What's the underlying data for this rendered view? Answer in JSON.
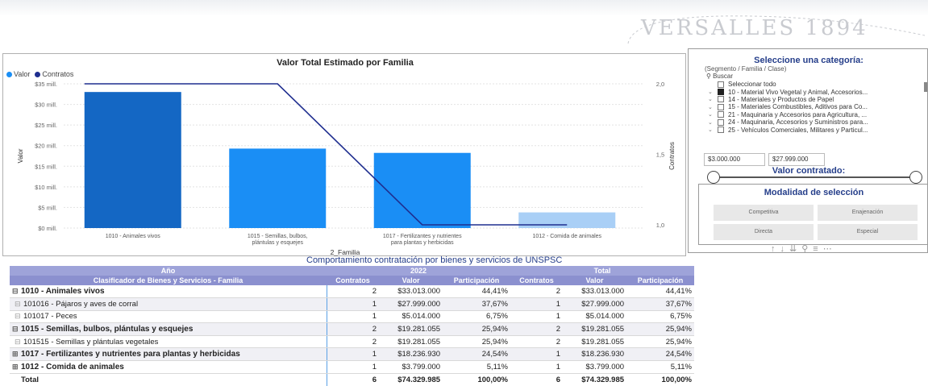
{
  "brand": {
    "logo_text": "VERSALLES 1894"
  },
  "chart_data": {
    "type": "bar",
    "title": "Valor Total Estimado por Familia",
    "xlabel": "2_Familia",
    "ylabel": "Valor",
    "y2label": "Contratos",
    "legend": [
      "Valor",
      "Contratos"
    ],
    "categories": [
      "1010 - Animales vivos",
      "1015 - Semillas, bulbos, plántulas y esquejes",
      "1017 - Fertilizantes y nutrientes para plantas y herbicidas",
      "1012 - Comida de animales"
    ],
    "category_lines": [
      [
        "1010 - Animales vivos"
      ],
      [
        "1015 - Semillas, bulbos,",
        "plántulas y esquejes"
      ],
      [
        "1017 - Fertilizantes y nutrientes",
        "para plantas y herbicidas"
      ],
      [
        "1012 - Comida de animales"
      ]
    ],
    "series": [
      {
        "name": "Valor",
        "axis": "left",
        "values": [
          33013000,
          19281055,
          18236930,
          3799000
        ],
        "colors": [
          "#1467c4",
          "#1a8ef5",
          "#1a8ef5",
          "#a9cff6"
        ]
      },
      {
        "name": "Contratos",
        "axis": "right",
        "type": "line",
        "values": [
          2,
          2,
          1,
          1
        ],
        "color": "#1f2e8f"
      }
    ],
    "y_ticks": [
      "$0 mill.",
      "$5 mill.",
      "$10 mill.",
      "$15 mill.",
      "$20 mill.",
      "$25 mill.",
      "$30 mill.",
      "$35 mill."
    ],
    "y2_ticks": [
      "1,0",
      "1,5",
      "2,0"
    ],
    "ylim": [
      0,
      35000000
    ],
    "y2lim": [
      1,
      2
    ]
  },
  "category_slicer": {
    "title": "Seleccione una categoría:",
    "subtitle": "(Segmento / Familia / Clase)",
    "search_placeholder": "Buscar",
    "items": [
      {
        "label": "Seleccionar todo",
        "checked": false,
        "expand": false
      },
      {
        "label": "10 - Material Vivo Vegetal y Animal, Accesorios...",
        "checked": true,
        "expand": true
      },
      {
        "label": "14 - Materiales y Productos de Papel",
        "checked": false,
        "expand": true
      },
      {
        "label": "15 - Materiales Combustibles, Aditivos para Co...",
        "checked": false,
        "expand": true
      },
      {
        "label": "21 - Maquinaria y Accesorios para Agricultura, ...",
        "checked": false,
        "expand": true
      },
      {
        "label": "24 - Maquinaria, Accesorios y Suministros para...",
        "checked": false,
        "expand": true
      },
      {
        "label": "25 - Vehículos Comerciales, Militares y Particul...",
        "checked": false,
        "expand": true
      }
    ]
  },
  "value_slicer": {
    "title": "Valor contratado:",
    "min": "$3.000.000",
    "max": "$27.999.000"
  },
  "modality": {
    "title": "Modalidad de selección",
    "options": [
      "Competitiva",
      "Enajenación",
      "Directa",
      "Especial"
    ]
  },
  "table": {
    "title": "Comportamiento contratación por bienes y servicios de UNSPSC",
    "year_header": "Año",
    "year": "2022",
    "total_header": "Total",
    "row_header": "Clasificador de Bienes y Servicios - Familia",
    "col_headers": [
      "Contratos",
      "Valor",
      "Participación",
      "Contratos",
      "Valor",
      "Participación"
    ],
    "rows": [
      {
        "level": 1,
        "icon": "⊟",
        "label": "1010 - Animales vivos",
        "values": [
          "2",
          "$33.013.000",
          "44,41%",
          "2",
          "$33.013.000",
          "44,41%"
        ]
      },
      {
        "level": 2,
        "icon": "⊟",
        "label": "101016 - Pájaros y aves de corral",
        "values": [
          "1",
          "$27.999.000",
          "37,67%",
          "1",
          "$27.999.000",
          "37,67%"
        ]
      },
      {
        "level": 2,
        "icon": "⊟",
        "label": "101017 - Peces",
        "values": [
          "1",
          "$5.014.000",
          "6,75%",
          "1",
          "$5.014.000",
          "6,75%"
        ]
      },
      {
        "level": 1,
        "icon": "⊟",
        "label": "1015 - Semillas, bulbos, plántulas y esquejes",
        "values": [
          "2",
          "$19.281.055",
          "25,94%",
          "2",
          "$19.281.055",
          "25,94%"
        ]
      },
      {
        "level": 2,
        "icon": "⊟",
        "label": "101515 - Semillas y plántulas vegetales",
        "values": [
          "2",
          "$19.281.055",
          "25,94%",
          "2",
          "$19.281.055",
          "25,94%"
        ]
      },
      {
        "level": 1,
        "icon": "⊞",
        "label": "1017 - Fertilizantes y nutrientes para plantas y herbicidas",
        "values": [
          "1",
          "$18.236.930",
          "24,54%",
          "1",
          "$18.236.930",
          "24,54%"
        ]
      },
      {
        "level": 1,
        "icon": "⊞",
        "label": "1012 - Comida de animales",
        "values": [
          "1",
          "$3.799.000",
          "5,11%",
          "1",
          "$3.799.000",
          "5,11%"
        ]
      }
    ],
    "total": {
      "label": "Total",
      "values": [
        "6",
        "$74.329.985",
        "100,00%",
        "6",
        "$74.329.985",
        "100,00%"
      ]
    }
  }
}
